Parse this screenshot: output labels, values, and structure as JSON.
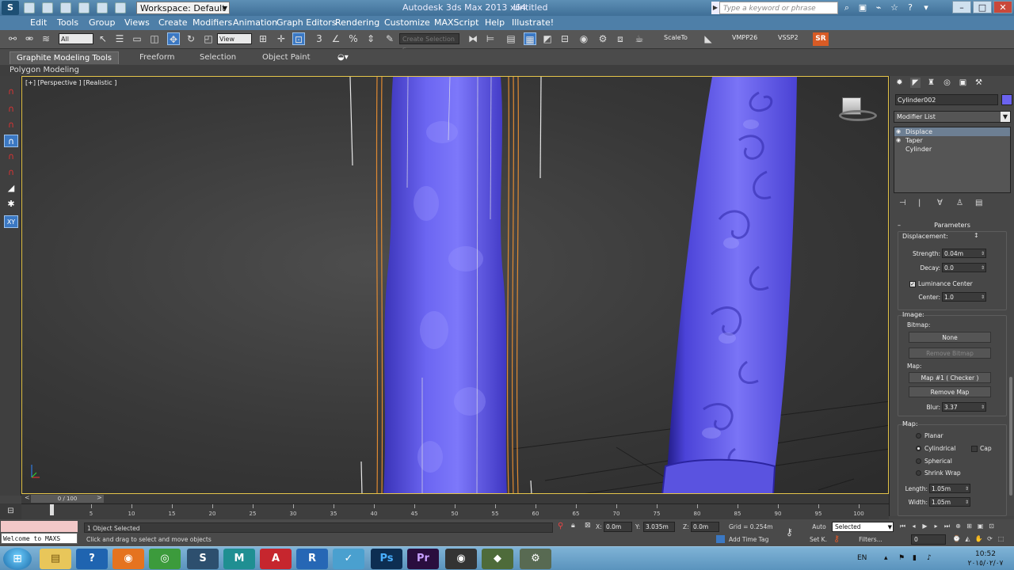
{
  "window": {
    "logo": "S",
    "workspace": "Workspace: Default",
    "app_title": "Autodesk 3ds Max  2013 x64",
    "doc_title": "Untitled",
    "search_placeholder": "Type a keyword or phrase"
  },
  "menu": [
    "Edit",
    "Tools",
    "Group",
    "Views",
    "Create",
    "Modifiers",
    "Animation",
    "Graph Editors",
    "Rendering",
    "Customize",
    "MAXScript",
    "Help",
    "Illustrate!"
  ],
  "toolbar": {
    "filter_select": "All",
    "refcoord_select": "View",
    "named_selection": "Create Selection S",
    "scale_to": "ScaleTo",
    "vmpp": "VMPP26",
    "vssp": "VSSP2",
    "sr": "SR"
  },
  "ribbon": {
    "tabs": [
      "Graphite Modeling Tools",
      "Freeform",
      "Selection",
      "Object Paint"
    ],
    "sub": "Polygon Modeling"
  },
  "viewport": {
    "label": "[+] [Perspective ] [Realistic ]"
  },
  "command_panel": {
    "object_name": "Cylinder002",
    "object_color": "#6b63f0",
    "modifier_list": "Modifier List",
    "stack": [
      "Displace",
      "Taper",
      "Cylinder"
    ],
    "rollout": "Parameters",
    "displacement_label": "Displacement:",
    "strength_label": "Strength:",
    "strength": "0.04m",
    "decay_label": "Decay:",
    "decay": "0.0",
    "luminance_label": "Luminance Center",
    "center_label": "Center:",
    "center": "1.0",
    "image_label": "Image:",
    "bitmap_label": "Bitmap:",
    "bitmap_btn": "None",
    "remove_bitmap": "Remove Bitmap",
    "map_label": "Map:",
    "map_btn": "Map #1 ( Checker )",
    "remove_map": "Remove Map",
    "blur_label": "Blur:",
    "blur": "3.37",
    "map_group": "Map:",
    "planar": "Planar",
    "cylindrical": "Cylindrical",
    "cap": "Cap",
    "spherical": "Spherical",
    "shrink_wrap": "Shrink Wrap",
    "length_label": "Length:",
    "length": "1.05m",
    "width_label": "Width:",
    "width": "1.05m"
  },
  "timeline": {
    "frame_display": "0 / 100",
    "prev": "<",
    "next": ">",
    "ticks": [
      "5",
      "10",
      "15",
      "20",
      "25",
      "30",
      "35",
      "40",
      "45",
      "50",
      "55",
      "60",
      "65",
      "70",
      "75",
      "80",
      "85",
      "90",
      "95",
      "100"
    ]
  },
  "status": {
    "maxscript_line": "Welcome to MAXS",
    "selected": "1 Object Selected",
    "prompt": "Click and drag to select and move objects",
    "x_label": "X:",
    "x": "0.0m",
    "y_label": "Y:",
    "y": "3.035m",
    "z_label": "Z:",
    "z": "0.0m",
    "grid": "Grid = 0.254m",
    "add_time_tag": "Add Time Tag",
    "auto": "Auto",
    "set_k": "Set K.",
    "selected_dd": "Selected",
    "filters": "Filters...",
    "frame": "0"
  },
  "taskbar": {
    "lang": "EN",
    "time": "10:52",
    "date": "٢٠١٥/٠٢/٠٧"
  }
}
